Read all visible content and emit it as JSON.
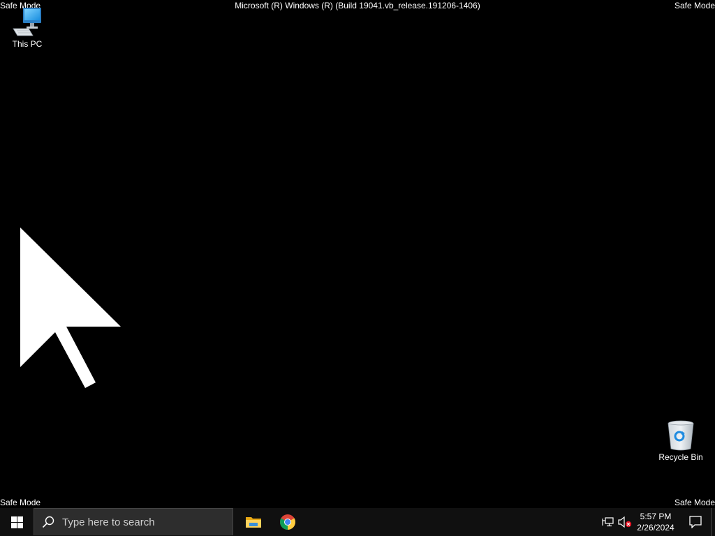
{
  "desktop": {
    "safe_mode_label": "Safe Mode",
    "build_label": "Microsoft (R) Windows (R) (Build 19041.vb_release.191206-1406)",
    "icons": [
      {
        "label": "This PC",
        "icon": "computer-icon"
      },
      {
        "label": "Recycle Bin",
        "icon": "recycle-bin-icon"
      }
    ],
    "background_color": "#000000"
  },
  "taskbar": {
    "search_placeholder": "Type here to search",
    "pinned_apps": [
      {
        "name": "File Explorer",
        "icon": "folder-icon"
      },
      {
        "name": "Google Chrome",
        "icon": "chrome-icon"
      }
    ],
    "tray": {
      "network_icon": "network-icon",
      "volume_icon": "volume-muted-icon",
      "time": "5:57 PM",
      "date": "2/26/2024"
    },
    "colors": {
      "background": "#101010",
      "search_bg": "#2d2d2d",
      "windows_logo": "#ffffff"
    }
  }
}
